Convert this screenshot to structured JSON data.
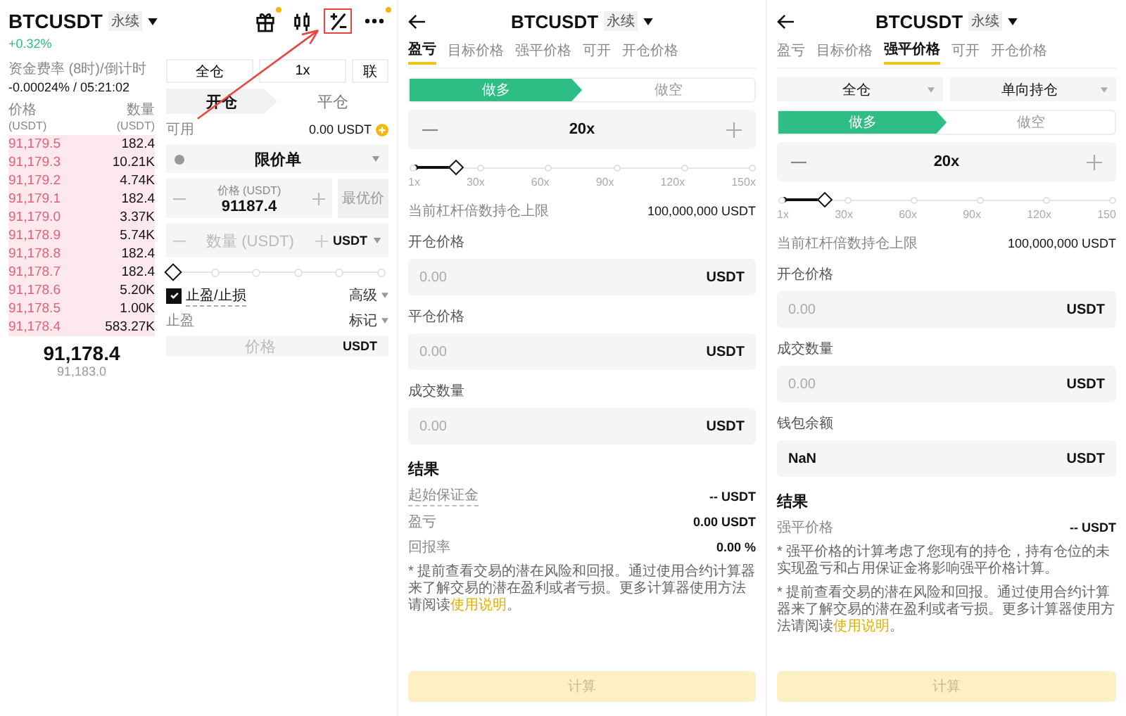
{
  "trade": {
    "symbol": "BTCUSDT",
    "tag": "永续",
    "change": "+0.32%",
    "toolbar": [
      {
        "kind": "gift",
        "badge": true,
        "highlighted": false
      },
      {
        "kind": "candles",
        "badge": false,
        "highlighted": false
      },
      {
        "kind": "calculator",
        "badge": false,
        "highlighted": true
      },
      {
        "kind": "more",
        "badge": true,
        "highlighted": false
      }
    ],
    "funding_label": "资金费率 (8时)/倒计时",
    "funding_value": "-0.00024% / 05:21:02",
    "book_headers": [
      {
        "label": "价格",
        "unit": "(USDT)"
      },
      {
        "label": "数量",
        "unit": "(USDT)"
      }
    ],
    "asks": [
      {
        "price": "91,179.5",
        "amount": "182.4"
      },
      {
        "price": "91,179.3",
        "amount": "10.21K"
      },
      {
        "price": "91,179.2",
        "amount": "4.74K"
      },
      {
        "price": "91,179.1",
        "amount": "182.4"
      },
      {
        "price": "91,179.0",
        "amount": "3.37K"
      },
      {
        "price": "91,178.9",
        "amount": "5.74K"
      },
      {
        "price": "91,178.8",
        "amount": "182.4"
      },
      {
        "price": "91,178.7",
        "amount": "182.4"
      },
      {
        "price": "91,178.6",
        "amount": "5.20K"
      },
      {
        "price": "91,178.5",
        "amount": "1.00K"
      },
      {
        "price": "91,178.4",
        "amount": "583.27K"
      }
    ],
    "last_price": "91,178.4",
    "mark_price": "91,183.0",
    "modes": [
      "全仓",
      "1x",
      "联"
    ],
    "tabs": [
      {
        "label": "开仓",
        "selected": true
      },
      {
        "label": "平仓",
        "selected": false
      }
    ],
    "available_label": "可用",
    "available_value": "0.00 USDT",
    "order_type": "限价单",
    "price_field": {
      "label": "价格 (USDT)",
      "value": "91187.4"
    },
    "best_price": "最优价",
    "qty_field": {
      "placeholder": "数量 (USDT)",
      "unit": "USDT"
    },
    "amount_slider": {
      "level": 0
    },
    "tpsl": {
      "label": "止盈/止损",
      "checked": true
    },
    "advanced": "高级",
    "take_profit_label": "止盈",
    "trigger": "标记",
    "tp_field": {
      "placeholder": "价格",
      "unit": "USDT"
    }
  },
  "calculators": [
    {
      "symbol": "BTCUSDT",
      "tag": "永续",
      "tabs": [
        {
          "label": "盈亏",
          "selected": true
        },
        {
          "label": "目标价格",
          "selected": false
        },
        {
          "label": "强平价格",
          "selected": false
        },
        {
          "label": "可开",
          "selected": false
        },
        {
          "label": "开仓价格",
          "selected": false
        }
      ],
      "sides": [
        {
          "label": "做多",
          "selected": true
        },
        {
          "label": "做空",
          "selected": false
        }
      ],
      "leverage": {
        "value": "20x",
        "level": 0.13,
        "ticks": [
          "1x",
          "30x",
          "60x",
          "90x",
          "120x",
          "150x"
        ]
      },
      "limit": {
        "label": "当前杠杆倍数持仓上限",
        "value": "100,000,000 USDT"
      },
      "fields": [
        {
          "label": "开仓价格",
          "placeholder": "0.00",
          "unit": "USDT"
        },
        {
          "label": "平仓价格",
          "placeholder": "0.00",
          "unit": "USDT"
        },
        {
          "label": "成交数量",
          "placeholder": "0.00",
          "unit": "USDT"
        }
      ],
      "results_title": "结果",
      "results": [
        {
          "label": "起始保证金",
          "value": "-- USDT",
          "underlined": true
        },
        {
          "label": "盈亏",
          "value": "0.00 USDT",
          "underlined": false
        },
        {
          "label": "回报率",
          "value": "0.00 %",
          "underlined": false
        }
      ],
      "notes": [
        {
          "text": "* 提前查看交易的潜在风险和回报。通过使用合约计算器来了解交易的潜在盈利或者亏损。更多计算器使用方法请阅读",
          "link": "使用说明",
          "after": "。"
        }
      ],
      "button": {
        "label": "计算",
        "disabled": true
      }
    },
    {
      "symbol": "BTCUSDT",
      "tag": "永续",
      "tabs": [
        {
          "label": "盈亏",
          "selected": false
        },
        {
          "label": "目标价格",
          "selected": false
        },
        {
          "label": "强平价格",
          "selected": true
        },
        {
          "label": "可开",
          "selected": false
        },
        {
          "label": "开仓价格",
          "selected": false
        }
      ],
      "selects": [
        "全仓",
        "单向持仓"
      ],
      "sides": [
        {
          "label": "做多",
          "selected": true
        },
        {
          "label": "做空",
          "selected": false
        }
      ],
      "leverage": {
        "value": "20x",
        "level": 0.13,
        "ticks": [
          "1x",
          "30x",
          "60x",
          "90x",
          "120x",
          "150"
        ]
      },
      "limit": {
        "label": "当前杠杆倍数持仓上限",
        "value": "100,000,000 USDT"
      },
      "fields": [
        {
          "label": "开仓价格",
          "placeholder": "0.00",
          "unit": "USDT"
        },
        {
          "label": "成交数量",
          "placeholder": "0.00",
          "unit": "USDT"
        },
        {
          "label": "钱包余额",
          "value": "NaN",
          "unit": "USDT"
        }
      ],
      "results_title": "结果",
      "results": [
        {
          "label": "强平价格",
          "value": "-- USDT",
          "underlined": false
        }
      ],
      "notes": [
        {
          "text": "* 强平价格的计算考虑了您现有的持仓，持有仓位的未实现盈亏和占用保证金将影响强平价格计算。"
        },
        {
          "text": "* 提前查看交易的潜在风险和回报。通过使用合约计算器来了解交易的潜在盈利或者亏损。更多计算器使用方法请阅读",
          "link": "使用说明",
          "after": "。"
        }
      ],
      "button": {
        "label": "计算",
        "disabled": true
      }
    }
  ]
}
